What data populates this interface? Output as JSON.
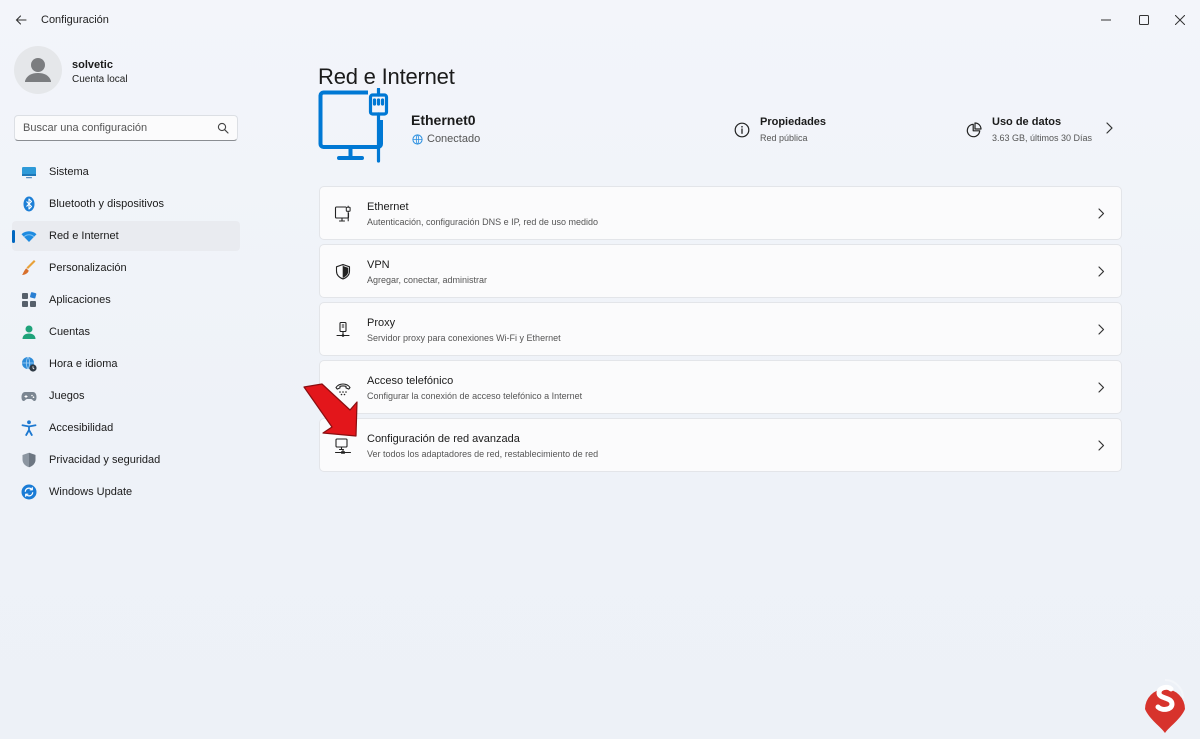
{
  "window": {
    "title": "Configuración"
  },
  "profile": {
    "name": "solvetic",
    "account_type": "Cuenta local"
  },
  "search": {
    "placeholder": "Buscar una configuración"
  },
  "sidebar": {
    "items": [
      {
        "label": "Sistema",
        "icon": "monitor-icon",
        "active": false
      },
      {
        "label": "Bluetooth y dispositivos",
        "icon": "bluetooth-icon",
        "active": false
      },
      {
        "label": "Red e Internet",
        "icon": "wifi-icon",
        "active": true
      },
      {
        "label": "Personalización",
        "icon": "brush-icon",
        "active": false
      },
      {
        "label": "Aplicaciones",
        "icon": "apps-icon",
        "active": false
      },
      {
        "label": "Cuentas",
        "icon": "person-icon",
        "active": false
      },
      {
        "label": "Hora e idioma",
        "icon": "globe-clock-icon",
        "active": false
      },
      {
        "label": "Juegos",
        "icon": "gamepad-icon",
        "active": false
      },
      {
        "label": "Accesibilidad",
        "icon": "accessibility-icon",
        "active": false
      },
      {
        "label": "Privacidad y seguridad",
        "icon": "shield-icon",
        "active": false
      },
      {
        "label": "Windows Update",
        "icon": "update-icon",
        "active": false
      }
    ]
  },
  "main": {
    "title": "Red e Internet",
    "connection": {
      "name": "Ethernet0",
      "status": "Conectado"
    },
    "properties": {
      "title": "Propiedades",
      "subtitle": "Red pública"
    },
    "data_usage": {
      "title": "Uso de datos",
      "subtitle": "3.63 GB, últimos 30 Días"
    },
    "cards": [
      {
        "title": "Ethernet",
        "subtitle": "Autenticación, configuración DNS e IP, red de uso medido",
        "icon": "ethernet-icon"
      },
      {
        "title": "VPN",
        "subtitle": "Agregar, conectar, administrar",
        "icon": "vpn-shield-icon"
      },
      {
        "title": "Proxy",
        "subtitle": "Servidor proxy para conexiones Wi-Fi y Ethernet",
        "icon": "proxy-icon"
      },
      {
        "title": "Acceso telefónico",
        "subtitle": "Configurar la conexión de acceso telefónico a Internet",
        "icon": "dialup-icon"
      },
      {
        "title": "Configuración de red avanzada",
        "subtitle": "Ver todos los adaptadores de red, restablecimiento de red",
        "icon": "advanced-network-icon"
      }
    ]
  },
  "colors": {
    "accent": "#0067c0",
    "hero_blue": "#0078d4",
    "arrow_red": "#e3161b"
  }
}
